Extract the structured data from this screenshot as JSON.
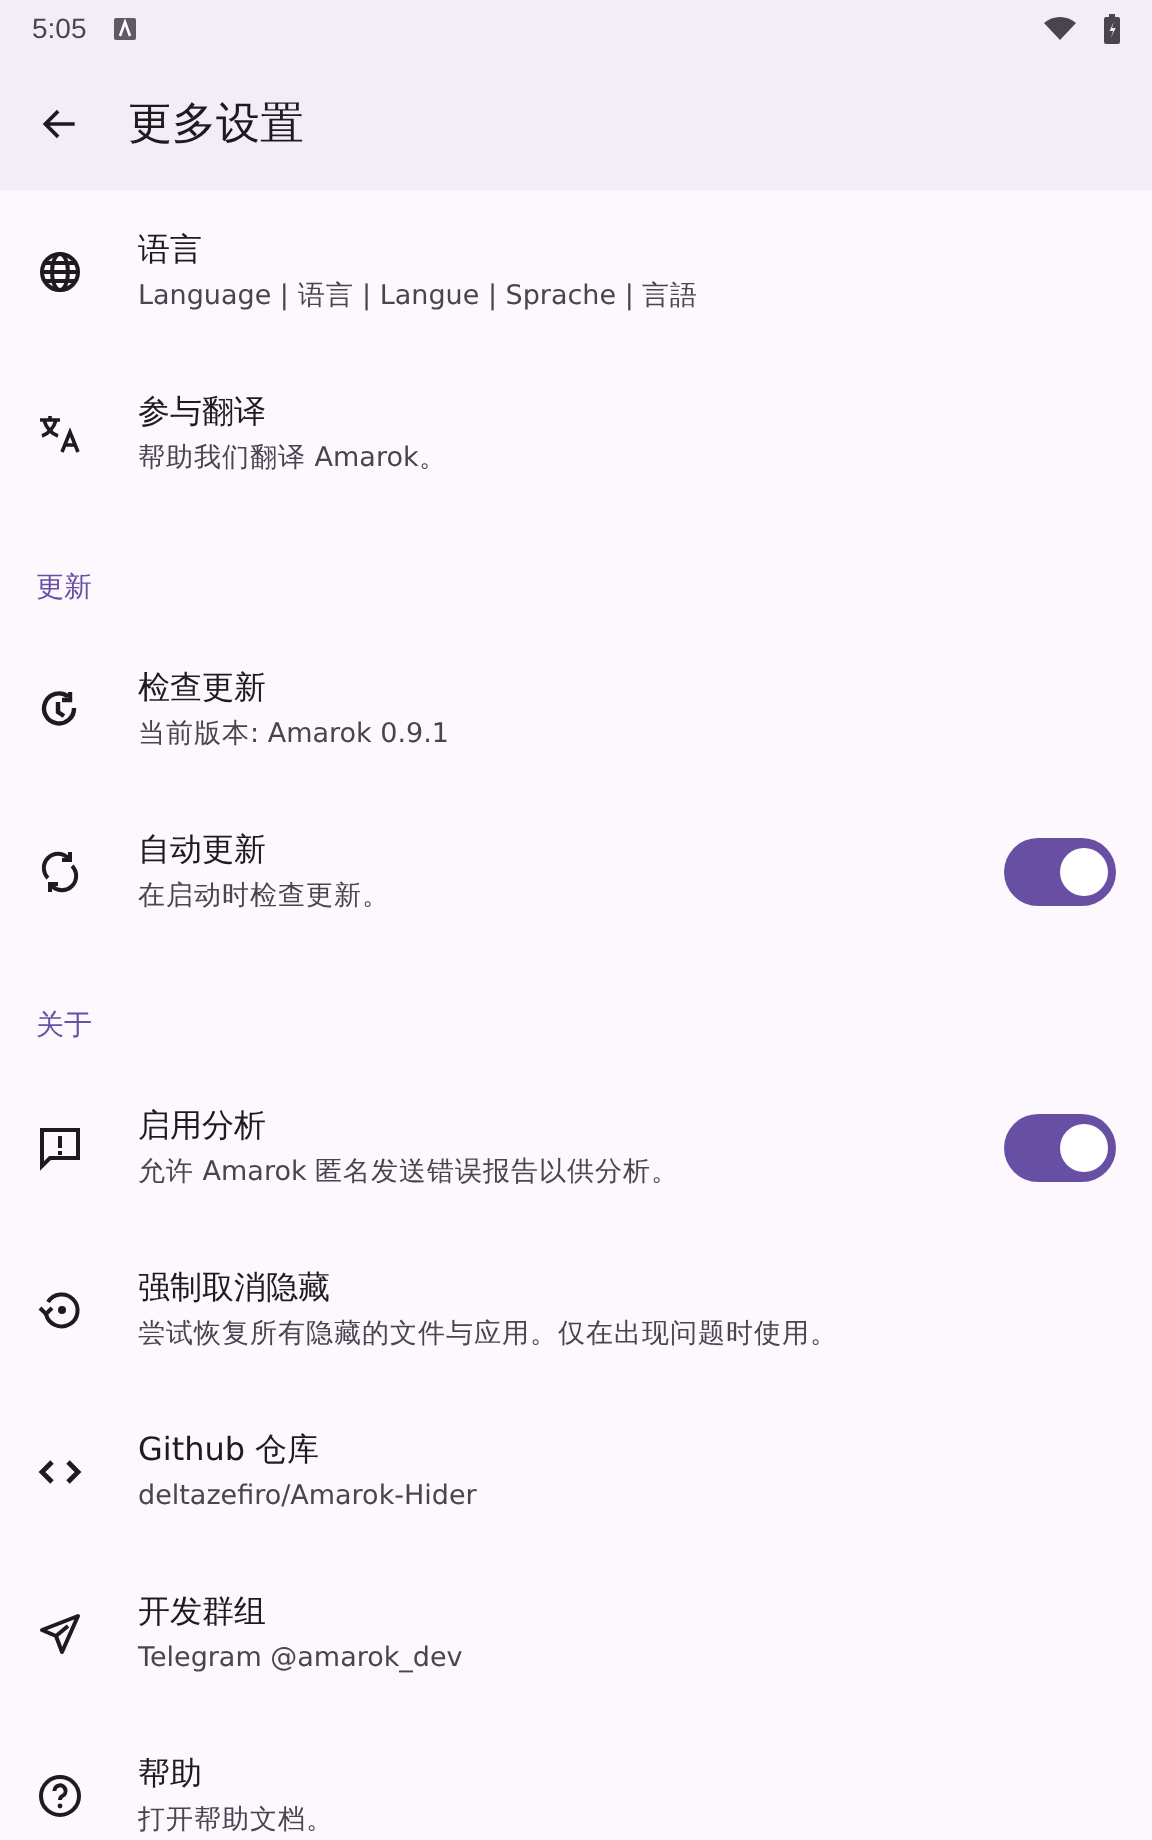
{
  "status_bar": {
    "time": "5:05"
  },
  "app_bar": {
    "title": "更多设置"
  },
  "sections": [
    {
      "items": [
        {
          "kind": "plain",
          "title": "语言",
          "subtitle": "Language | 语言 | Langue | Sprache | 言語"
        },
        {
          "kind": "plain",
          "title": "参与翻译",
          "subtitle": "帮助我们翻译 Amarok。"
        }
      ]
    },
    {
      "header": "更新",
      "items": [
        {
          "kind": "plain",
          "title": "检查更新",
          "subtitle": "当前版本: Amarok 0.9.1"
        },
        {
          "kind": "toggle",
          "title": "自动更新",
          "subtitle": "在启动时检查更新。",
          "on": true
        }
      ]
    },
    {
      "header": "关于",
      "items": [
        {
          "kind": "toggle",
          "title": "启用分析",
          "subtitle": "允许 Amarok 匿名发送错误报告以供分析。",
          "on": true
        },
        {
          "kind": "plain",
          "title": "强制取消隐藏",
          "subtitle": "尝试恢复所有隐藏的文件与应用。仅在出现问题时使用。"
        },
        {
          "kind": "plain",
          "title": "Github 仓库",
          "subtitle": "deltazefiro/Amarok-Hider"
        },
        {
          "kind": "plain",
          "title": "开发群组",
          "subtitle": "Telegram @amarok_dev"
        },
        {
          "kind": "plain",
          "title": "帮助",
          "subtitle": "打开帮助文档。"
        }
      ]
    }
  ]
}
